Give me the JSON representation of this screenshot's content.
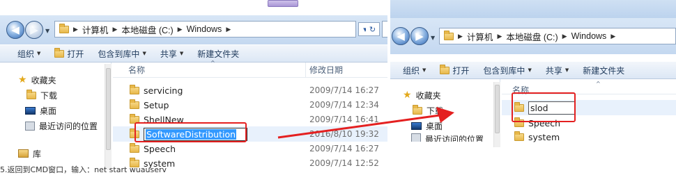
{
  "left_window": {
    "breadcrumb": [
      "计算机",
      "本地磁盘 (C:)",
      "Windows"
    ],
    "toolbar": {
      "organize": "组织",
      "open": "打开",
      "include_in_library": "包含到库中",
      "share": "共享",
      "new_folder": "新建文件夹"
    },
    "nav": {
      "favorites": "收藏夹",
      "downloads": "下载",
      "desktop": "桌面",
      "recent": "最近访问的位置",
      "libraries": "库"
    },
    "columns": {
      "name": "名称",
      "modified": "修改日期"
    },
    "rows": [
      {
        "name": "servicing",
        "date": "2009/7/14 16:27"
      },
      {
        "name": "Setup",
        "date": "2009/7/14 12:34"
      },
      {
        "name": "ShellNew",
        "date": "2009/7/14 16:41"
      },
      {
        "name": "SoftwareDistribution",
        "date": "2016/8/10 19:32"
      },
      {
        "name": "Speech",
        "date": "2009/7/14 16:27"
      },
      {
        "name": "system",
        "date": "2009/7/14 12:52"
      }
    ]
  },
  "right_window": {
    "breadcrumb": [
      "计算机",
      "本地磁盘 (C:)",
      "Windows"
    ],
    "toolbar": {
      "organize": "组织",
      "open": "打开",
      "include_in_library": "包含到库中",
      "share": "共享",
      "new_folder": "新建文件夹"
    },
    "nav": {
      "favorites": "收藏夹",
      "downloads": "下载",
      "desktop": "桌面",
      "recent": "最近访问的位置"
    },
    "columns": {
      "name": "名称"
    },
    "rows": [
      {
        "name": "slod"
      },
      {
        "name": "Speech"
      },
      {
        "name": "system"
      }
    ]
  },
  "caption": "5.返回到CMD窗口，输入：net start wuauserv",
  "icons": [
    "back-icon",
    "forward-icon",
    "folder-icon",
    "refresh-icon",
    "star-icon",
    "desktop-icon",
    "recent-icon",
    "library-icon",
    "open-icon"
  ],
  "colors": {
    "highlight": "#3399ff",
    "annotation": "#e42020"
  }
}
